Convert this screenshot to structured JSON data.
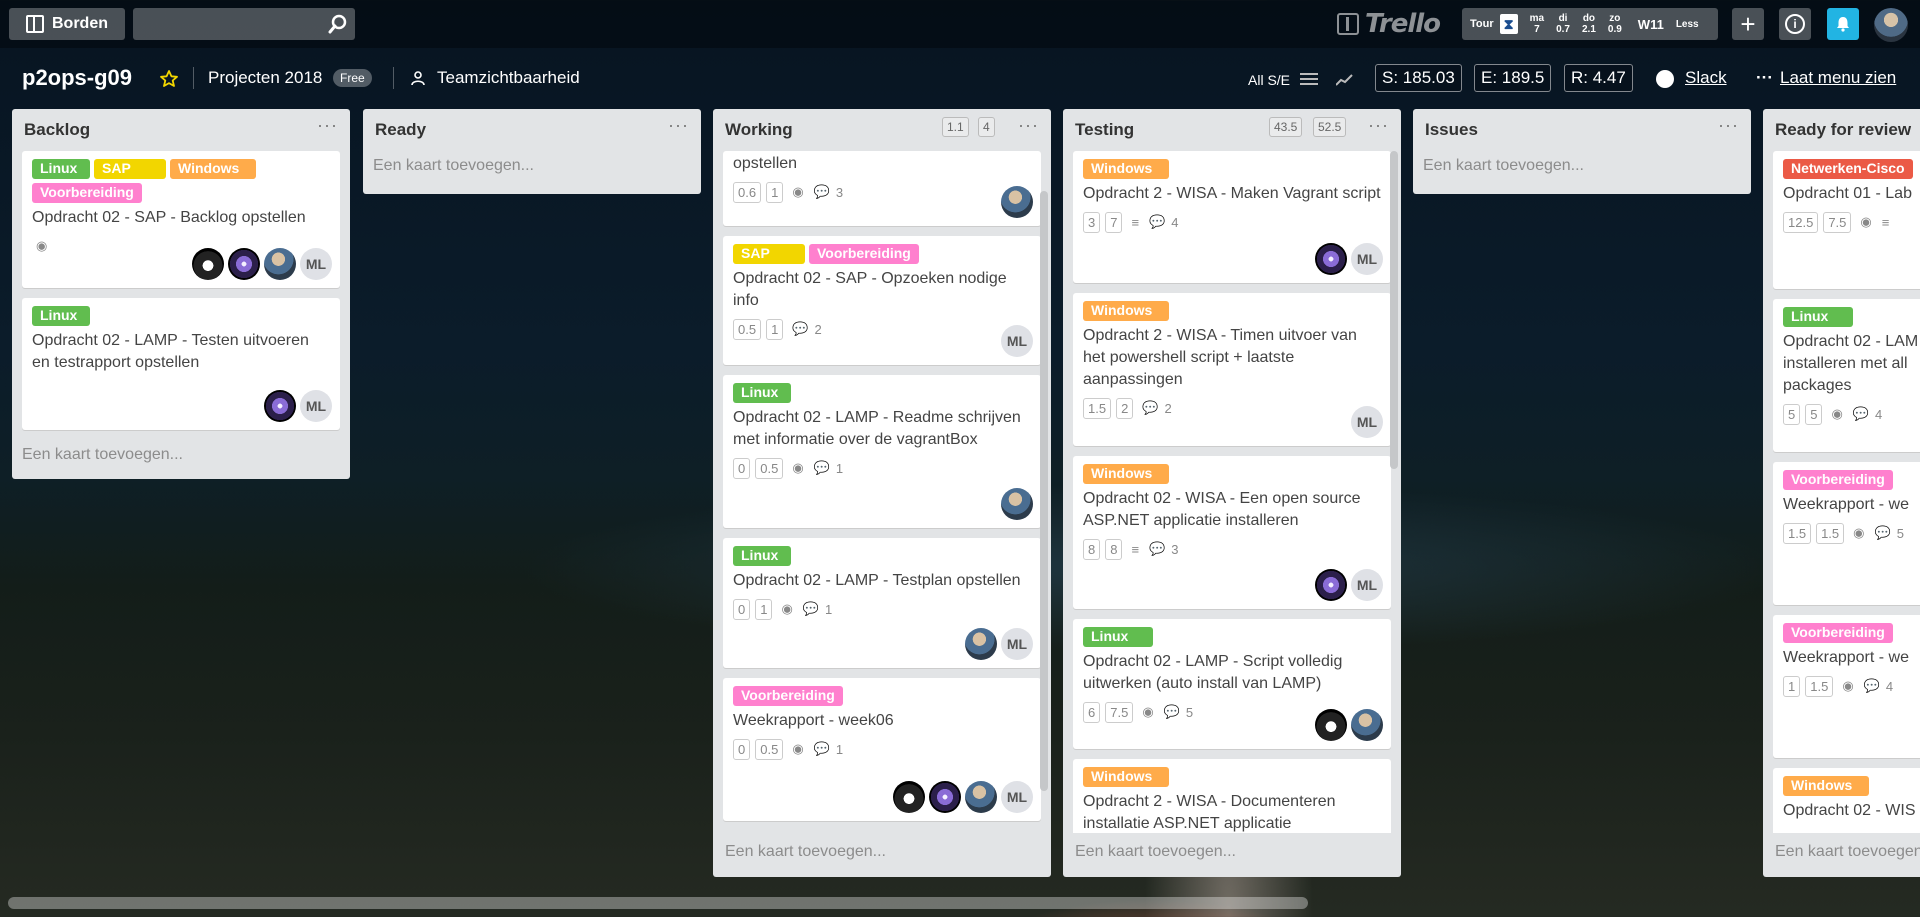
{
  "header": {
    "boards_label": "Borden",
    "search_placeholder": "",
    "logo_text": "Trello",
    "weather": {
      "tour_label": "Tour",
      "days": [
        {
          "day": "ma",
          "val": "7"
        },
        {
          "day": "di",
          "val": "0.7"
        },
        {
          "day": "do",
          "val": "2.1"
        },
        {
          "day": "zo",
          "val": "0.9"
        }
      ],
      "week": "W11",
      "less": "Less"
    },
    "plus": "+"
  },
  "board": {
    "title": "p2ops-g09",
    "team": "Projecten 2018",
    "plan": "Free",
    "visibility": "Teamzichtbaarheid",
    "filter": "All S/E",
    "stats": {
      "s": "S: 185.03",
      "e": "E: 189.5",
      "r": "R: 4.47"
    },
    "slack": "Slack",
    "menu": "Laat menu zien"
  },
  "add_card": "Een kaart toevoegen...",
  "lists": [
    {
      "title": "Backlog",
      "cards": [
        {
          "labels": [
            "Linux",
            "SAP",
            "Windows",
            "Voorbereiding"
          ],
          "title": "Opdracht 02 - SAP - Backlog opstellen",
          "ml": "ML"
        },
        {
          "labels": [
            "Linux"
          ],
          "title": "Opdracht 02 - LAMP - Testen uitvoeren en testrapport opstellen",
          "ml": "ML"
        }
      ]
    },
    {
      "title": "Ready",
      "cards": []
    },
    {
      "title": "Working",
      "pills": [
        "1.1",
        "4"
      ],
      "cards": [
        {
          "title": "opstellen",
          "est": "0.6",
          "spent": "1",
          "comments": "3"
        },
        {
          "labels": [
            "SAP",
            "Voorbereiding"
          ],
          "title": "Opdracht 02 - SAP - Opzoeken nodige info",
          "est": "0.5",
          "spent": "1",
          "comments": "2",
          "ml": "ML"
        },
        {
          "labels": [
            "Linux"
          ],
          "title": "Opdracht 02 - LAMP - Readme schrijven met informatie over de vagrantBox",
          "est": "0",
          "spent": "0.5",
          "comments": "1"
        },
        {
          "labels": [
            "Linux"
          ],
          "title": "Opdracht 02 - LAMP - Testplan opstellen",
          "est": "0",
          "spent": "1",
          "comments": "1",
          "ml": "ML"
        },
        {
          "labels": [
            "Voorbereiding"
          ],
          "title": "Weekrapport - week06",
          "est": "0",
          "spent": "0.5",
          "comments": "1",
          "ml": "ML"
        }
      ]
    },
    {
      "title": "Testing",
      "pills": [
        "43.5",
        "52.5"
      ],
      "cards": [
        {
          "labels": [
            "Windows"
          ],
          "title": "Opdracht 2 - WISA - Maken Vagrant script",
          "est": "3",
          "spent": "7",
          "comments": "4",
          "ml": "ML"
        },
        {
          "labels": [
            "Windows"
          ],
          "title": "Opdracht 2 - WISA - Timen uitvoer van het powershell script + laatste aanpassingen",
          "est": "1.5",
          "spent": "2",
          "comments": "2",
          "ml": "ML"
        },
        {
          "labels": [
            "Windows"
          ],
          "title": "Opdracht 02 - WISA - Een open source ASP.NET applicatie installeren",
          "est": "8",
          "spent": "8",
          "comments": "3",
          "ml": "ML"
        },
        {
          "labels": [
            "Linux"
          ],
          "title": "Opdracht 02 - LAMP - Script volledig uitwerken (auto install van LAMP)",
          "est": "6",
          "spent": "7.5",
          "comments": "5"
        },
        {
          "labels": [
            "Windows"
          ],
          "title": "Opdracht 2 - WISA - Documenteren installatie ASP.NET applicatie"
        }
      ]
    },
    {
      "title": "Issues",
      "cards": []
    },
    {
      "title": "Ready for review",
      "cards": [
        {
          "labels": [
            "Netwerken-Cisco"
          ],
          "title": "Opdracht 01 - Lab",
          "est": "12.5",
          "spent": "7.5"
        },
        {
          "labels": [
            "Linux"
          ],
          "title": "Opdracht 02 - LAM installeren met all packages",
          "est": "5",
          "spent": "5",
          "comments": "4"
        },
        {
          "labels": [
            "Voorbereiding"
          ],
          "title": "Weekrapport - we",
          "est": "1.5",
          "spent": "1.5",
          "comments": "5"
        },
        {
          "labels": [
            "Voorbereiding"
          ],
          "title": "Weekrapport - we",
          "est": "1",
          "spent": "1.5",
          "comments": "4"
        },
        {
          "labels": [
            "Windows"
          ],
          "title": "Opdracht 02 - WIS"
        }
      ]
    }
  ],
  "colors": {
    "green": "#61bd4f",
    "yellow": "#f2d600",
    "orange": "#ffab4a",
    "pink": "#ff80ce",
    "red": "#eb5a46",
    "notify": "#22b4e3"
  }
}
